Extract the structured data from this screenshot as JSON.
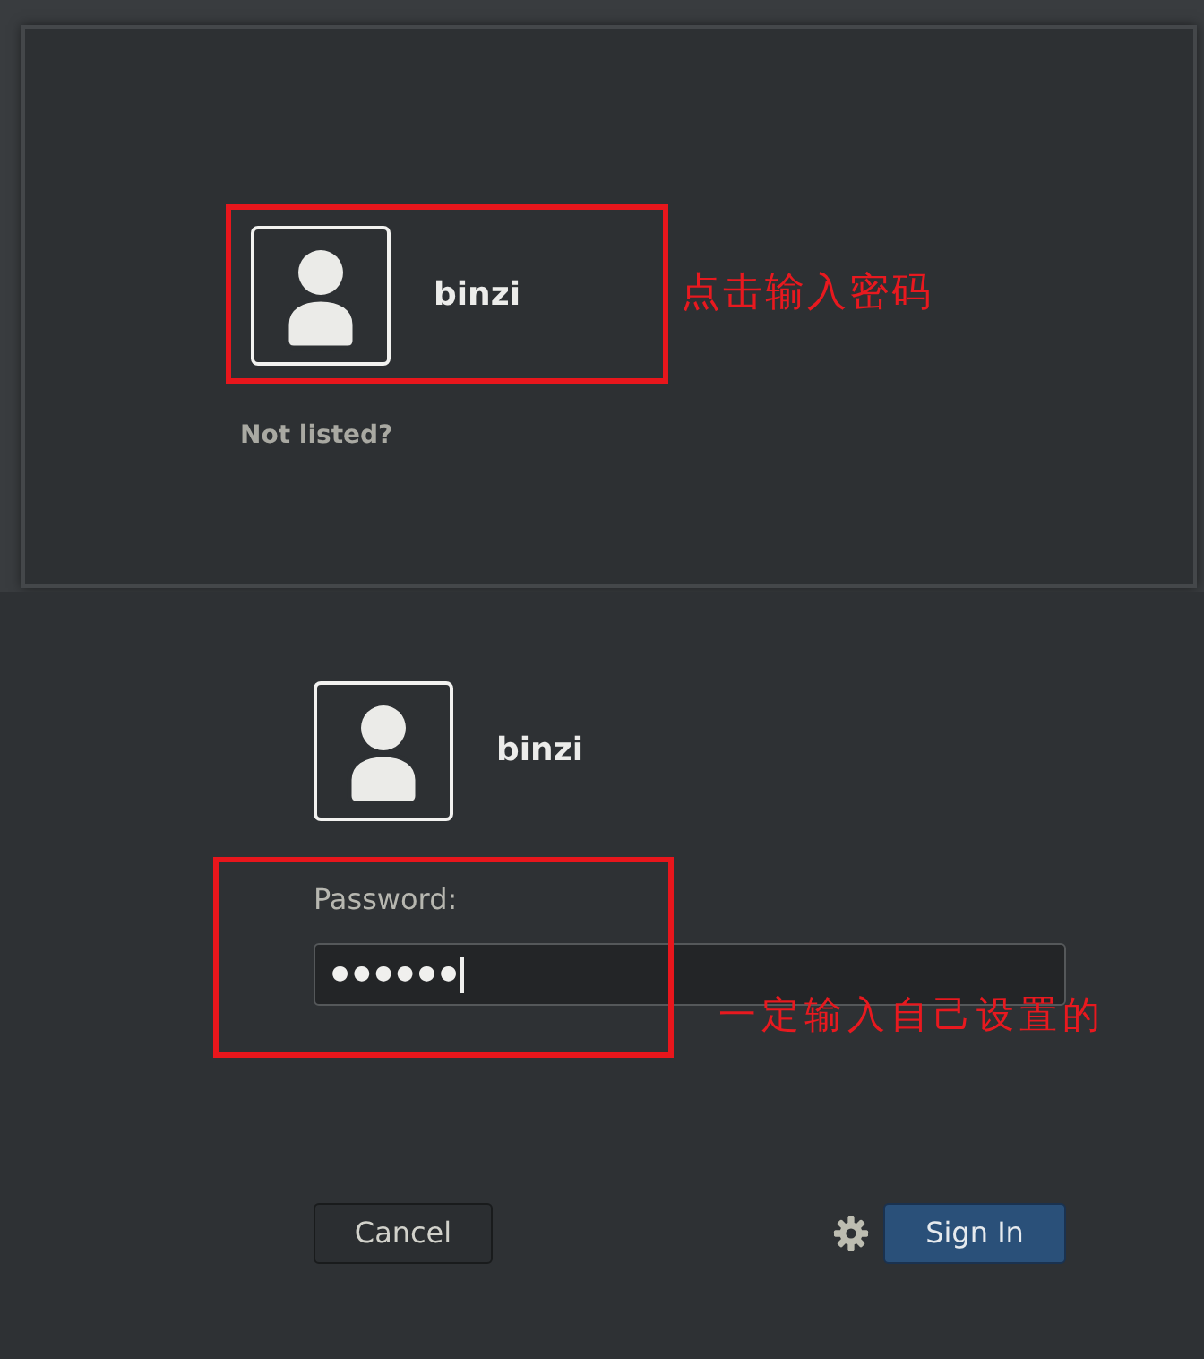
{
  "user_list_screen": {
    "users": [
      {
        "name": "binzi"
      }
    ],
    "annotation": "点击输入密码",
    "not_listed_link": "Not listed?"
  },
  "password_screen": {
    "user": {
      "name": "binzi"
    },
    "password_label": "Password:",
    "password_field": {
      "value": "●●●●●●",
      "focused": true
    },
    "annotation": "一定输入自己设置的",
    "buttons": [
      {
        "label": "Cancel",
        "kind": "secondary"
      },
      {
        "label": "Sign In",
        "kind": "primary"
      }
    ]
  }
}
